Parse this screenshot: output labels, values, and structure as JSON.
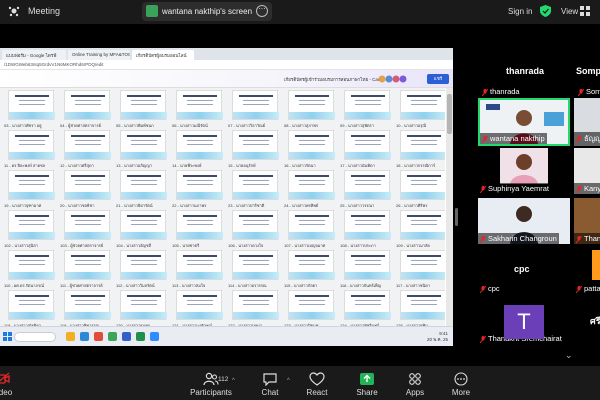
{
  "topbar": {
    "meeting_title": "Meeting",
    "share_label": "wantana nakthip's screen",
    "signin": "Sign in",
    "view": "View"
  },
  "browser": {
    "tabs": [
      {
        "label": "แบบฟอร์ม - Google ไดรฟ์"
      },
      {
        "label": "Online Training by MFA&TOGS"
      },
      {
        "label": "เกียรติบัตรผู้อบรมออนไลน์"
      }
    ],
    "url": "/1DWGWeb63ntq5GrdvV1N6MKORhd6rPDQ/edit",
    "ribbon_title": "เกียรติบัตรผู้เข้าร่วมอบรมการสอนภาษาไทย - Canva",
    "share_button": "แชร์"
  },
  "certificates": {
    "rows": [
      [
        "03 - นางสาวพัชรา อยู่",
        "04 - ผู้ช่วยศาสตราจารย์",
        "05 - นางสาวพิมพ์ชนก",
        "06 - นางสาวมณีรัตน์",
        "07 - นางสาววิลาวัณย์",
        "08 - นางสาวสุภาพร",
        "09 - นางสาวสุพัตรา",
        "10 - นางสาวอรุณี"
      ],
      [
        "11 - ดร.ปิยะพงษ์ สายชล",
        "12 - นางสาวศรีสุดา",
        "13 - นางสาวอภิญญา",
        "14 - นายพีระพงษ์",
        "15 - นายอนุรักษ์",
        "16 - นางสาวรัตนา",
        "17 - นางสาวนันทิดา",
        "18 - นางสาวกรรณิการ์"
      ],
      [
        "19 - นางสาวจุฑามาศ",
        "20 - นางสาวชลธิชา",
        "21 - นางสาวธิดารัตน์",
        "22 - นางสาวนภาพร",
        "23 - นางสาวปาริชาติ",
        "24 - นางสาวพรทิพย์",
        "25 - นางสาววรรณา",
        "26 - นางสาวศิริพร"
      ],
      [
        "102 - นางสาวสุนิสา",
        "103 - ผู้ช่วยศาสตราจารย์",
        "104 - นางสาวอัญชลี",
        "105 - นายชาตรี",
        "106 - นางสาวดวงใจ",
        "107 - นางสาวเบญจมาศ",
        "108 - นางสาวประภา",
        "109 - นางสาวมาลัย"
      ],
      [
        "110 - ผศ.ดร.รัตนาภรณ์",
        "111 - ผู้ช่วยศาสตราจารย์",
        "112 - นางสาววิมลรัตน์",
        "113 - นางสาวสมใจ",
        "114 - นางสาวอรวรรณ",
        "115 - นางสาวกัลยา",
        "116 - นางสาวจันทร์เพ็ญ",
        "117 - นางสาวชนิดา"
      ],
      [
        "118 - นางสาวณัฐธิดา",
        "119 - นางสาวทิพวรรณ",
        "120 - นางสาวธนพร",
        "121 - นางสาวนงลักษณ์",
        "122 - นางสาวบุษบา",
        "123 - นางสาวปิยนุช",
        "124 - นางสาวพัชรินทร์",
        "125 - นางสาวยุพิน"
      ]
    ]
  },
  "taskbar": {
    "time": "9:41",
    "date": "20 พ.ค. 25"
  },
  "gallery": {
    "col1_name": "thanrada",
    "col2_name": "Sompi",
    "participants": [
      {
        "name": "thanrada"
      },
      {
        "name": "Sompi"
      },
      {
        "name": "wantana nakthip"
      },
      {
        "name": "ธัญญ"
      },
      {
        "name": "Suphinya Yaemrat"
      },
      {
        "name": "Kanya"
      },
      {
        "name": "Sakharin Changroun"
      },
      {
        "name": "Thana"
      },
      {
        "name": "cpc"
      },
      {
        "name": "cpc"
      },
      {
        "name": "pattay"
      },
      {
        "name": "Thanakrit Sremchairat"
      },
      {
        "name": "ศรีนิ"
      }
    ],
    "t_avatar": "T"
  },
  "toolbar": {
    "video": "Video",
    "participants_label": "Participants",
    "participants_count": "112",
    "chat": "Chat",
    "react": "React",
    "share": "Share",
    "apps": "Apps",
    "more": "More"
  }
}
